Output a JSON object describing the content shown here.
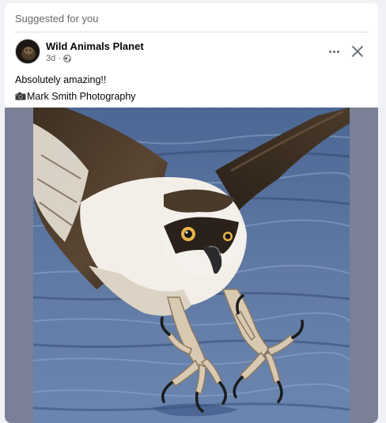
{
  "card": {
    "suggested_label": "Suggested for you"
  },
  "post": {
    "page_name": "Wild Animals Planet",
    "time": "3d",
    "separator": "·",
    "privacy_icon": "globe-icon",
    "text_line1": "Absolutely amazing!!",
    "text_line2": "Mark Smith Photography",
    "line2_icon": "camera-icon"
  },
  "actions": {
    "more_icon": "more-horizontal-icon",
    "close_icon": "close-icon"
  },
  "colors": {
    "background": "#f0f2f5",
    "card": "#ffffff",
    "secondary_text": "#65676b",
    "primary_text": "#050505",
    "media_letterbox": "#7a8196"
  }
}
